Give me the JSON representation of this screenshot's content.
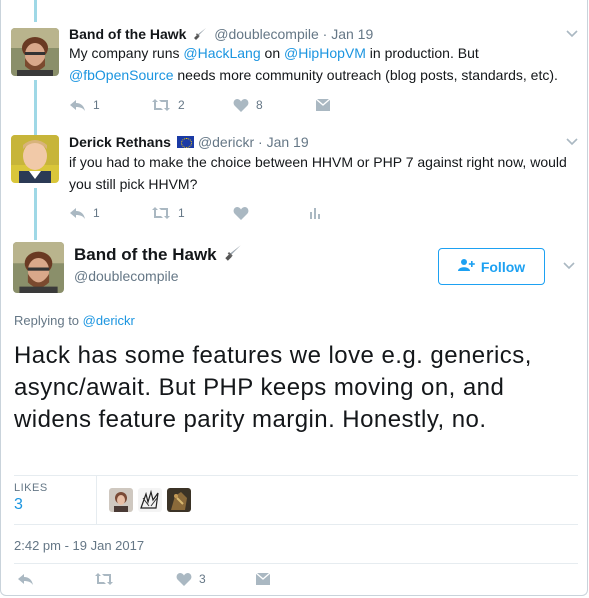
{
  "tweets": [
    {
      "name": "Band of the Hawk",
      "handle": "@doublecompile",
      "date": "· Jan 19",
      "text_parts": [
        "My company runs ",
        "@HackLang",
        " on ",
        "@HipHopVM",
        " in production. But ",
        "@fbOpenSource",
        " needs more community outreach (blog posts, standards, etc)."
      ],
      "replies": "1",
      "retweets": "2",
      "likes": "8"
    },
    {
      "name": "Derick Rethans",
      "handle": "@derickr",
      "date": "· Jan 19",
      "text": "if you had to make the choice between HHVM or PHP 7 against right now, would you still pick HHVM?",
      "replies": "1",
      "retweets": "1"
    }
  ],
  "main": {
    "name": "Band of the Hawk",
    "handle": "@doublecompile",
    "follow_label": "Follow",
    "replying_prefix": "Replying to ",
    "replying_to": "@derickr",
    "text": "Hack has some features we love e.g. generics, async/await. But PHP keeps moving on, and widens feature parity margin. Honestly, no.",
    "likes_label": "LIKES",
    "likes_count": "3",
    "timestamp": "2:42 pm - 19 Jan 2017",
    "footer_likes": "3"
  },
  "colors": {
    "accent": "#1da1f2",
    "link": "#1b95e0",
    "muted": "#657786",
    "thread_line": "#9fd8e6"
  },
  "icons": [
    "dagger-icon",
    "eu-flag-icon",
    "reply-icon",
    "retweet-icon",
    "heart-icon",
    "dm-icon",
    "analytics-icon",
    "chevron-down-icon",
    "follow-user-icon"
  ]
}
